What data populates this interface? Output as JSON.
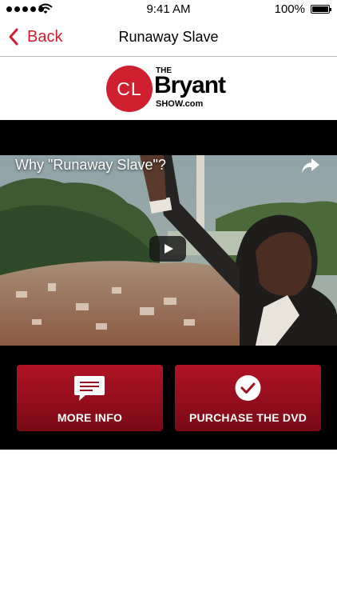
{
  "status_bar": {
    "time": "9:41 AM",
    "battery_percent": "100%",
    "battery_level": 1.0,
    "signal_bars": 5,
    "icons": [
      "signal-dots-icon",
      "wifi-icon",
      "battery-icon"
    ]
  },
  "nav": {
    "back_label": "Back",
    "title": "Runaway Slave",
    "accent_color": "#cc1f2d",
    "back_icon": "chevron-left-icon"
  },
  "logo": {
    "initials": "CL",
    "the": "THE",
    "name": "Bryant",
    "show": "SHOW.com",
    "brand_color": "#d0202f"
  },
  "video": {
    "title": "Why \"Runaway Slave\"?",
    "share_icon": "share-arrow-icon",
    "play_icon": "play-icon"
  },
  "buttons": {
    "more_info": {
      "label": "MORE INFO",
      "icon": "chat-bubble-icon"
    },
    "purchase": {
      "label": "PURCHASE THE DVD",
      "icon": "checkmark-circle-icon"
    },
    "color_top": "#b01324",
    "color_bottom": "#7a0a16"
  }
}
